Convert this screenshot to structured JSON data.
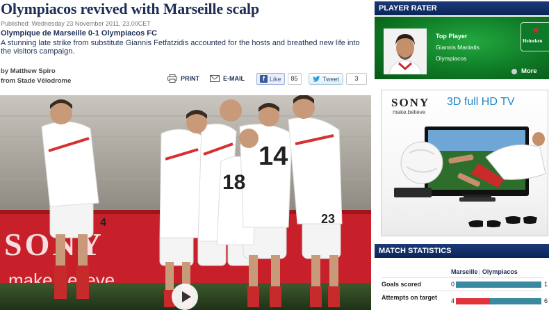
{
  "article": {
    "headline": "Olympiacos revived with Marseille scalp",
    "published": "Published: Wednesday 23 November 2011, 23.00CET",
    "subhead": "Olympique de Marseille 0-1 Olympiacos FC",
    "standfirst": "A stunning late strike from substitute Giannis Fetfatzidis accounted for the hosts and breathed new life into the visitors campaign.",
    "byline_author": "by Matthew Spiro",
    "byline_location": "from Stade Vélodrome"
  },
  "share": {
    "print_label": "PRINT",
    "email_label": "E-MAIL",
    "like_label": "Like",
    "like_count": "85",
    "tweet_label": "Tweet",
    "tweet_count": "3"
  },
  "video": {
    "play_icon": "play-icon",
    "board_brand": "SONY",
    "board_tag": "make.believe",
    "shirt_numbers": [
      "4",
      "14",
      "18",
      "23"
    ]
  },
  "player_rater": {
    "title": "PLAYER RATER",
    "label": "Top Player",
    "player": "Giannis Maniatis",
    "team": "Olympiacos",
    "sponsor": "Heineken",
    "more_label": "More"
  },
  "ad": {
    "brand": "SONY",
    "tagline": "make.believe",
    "headline": "3D full HD TV"
  },
  "match_stats": {
    "title": "MATCH STATISTICS",
    "home_team": "Marseille",
    "away_team": "Olympiacos",
    "rows": [
      {
        "label": "Goals scored",
        "home": "0",
        "away": "1",
        "home_share": 0,
        "away_share": 1
      },
      {
        "label": "Attempts on target",
        "home": "4",
        "away": "6",
        "home_share": 0.4,
        "away_share": 0.6
      }
    ]
  },
  "colors": {
    "headline_navy": "#1d2f57",
    "panel_navy": "#0b2558",
    "rater_green": "#0f7a26",
    "stat_home_red": "#e0343a",
    "stat_away_teal": "#3a89a0"
  }
}
